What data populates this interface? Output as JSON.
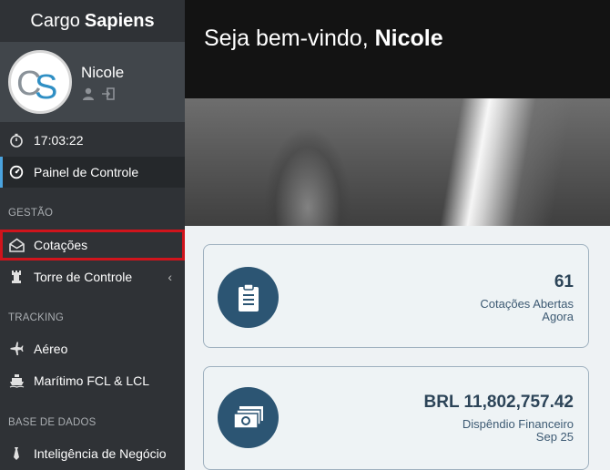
{
  "sidebar": {
    "brand_light": "Cargo",
    "brand_bold": "Sapiens",
    "user_name": "Nicole",
    "clock": "17:03:22",
    "dashboard": "Painel de Controle",
    "sections": {
      "gestao": "GESTÃO",
      "tracking": "TRACKING",
      "base": "BASE DE DADOS"
    },
    "items": {
      "cotacoes": "Cotações",
      "torre": "Torre de Controle",
      "aereo": "Aéreo",
      "maritimo": "Marítimo FCL & LCL",
      "inteligencia": "Inteligência de Negócio"
    }
  },
  "hero": {
    "greeting": "Seja bem-vindo,",
    "name": "Nicole"
  },
  "cards": [
    {
      "value": "61",
      "label_line1": "Cotações Abertas",
      "label_line2": "Agora",
      "icon": "clipboard-icon"
    },
    {
      "value": "BRL 11,802,757.42",
      "label_line1": "Dispêndio Financeiro",
      "label_line2": "Sep 25",
      "icon": "money-icon"
    }
  ],
  "colors": {
    "accent": "#4aa3df",
    "card_icon_bg": "#2c5573",
    "highlight": "#d0141c"
  }
}
